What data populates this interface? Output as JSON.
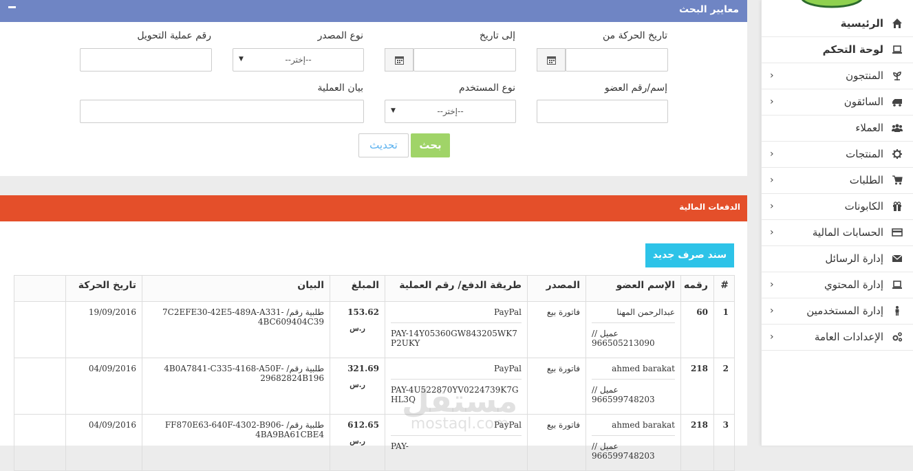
{
  "search": {
    "title": "معايير البحث",
    "labels": {
      "date_from": "تاريخ الحركة من",
      "date_to": "إلى تاريخ",
      "source_type": "نوع المصدر",
      "transfer_no": "رقم عملية التحويل",
      "member": "إسم/رقم العضو",
      "user_type": "نوع المستخدم",
      "description": "بيان العملية"
    },
    "select_placeholder": "--إختر--",
    "search_button": "بحث",
    "refresh_button": "تحديث"
  },
  "payments": {
    "title": "الدفعات المالية",
    "new_button": "سند صرف جديد",
    "columns": [
      "#",
      "رقمه",
      "الإسم العضو",
      "المصدر",
      "طريقة الدفع/ رقم العملية",
      "المبلغ",
      "البيان",
      "تاريخ الحركة"
    ],
    "rows": [
      {
        "idx": "1",
        "num": "60",
        "name": "عبدالرحمن المهنا",
        "phone": "عميل // 966505213090",
        "source": "فاتورة بيع",
        "method": "PayPal",
        "ref": "PAY-14Y05360GW843205WK7P2UKY",
        "amount": "153.62",
        "currency": "ر.س",
        "desc": "طلبية رقم/ -7C2EFE30-42E5-489A-A331 4BC609404C39",
        "date": "19/09/2016"
      },
      {
        "idx": "2",
        "num": "218",
        "name": "ahmed barakat",
        "phone": "عميل // 966599748203",
        "source": "فاتورة بيع",
        "method": "PayPal",
        "ref": "PAY-4U522870YV0224739K7GHL3Q",
        "amount": "321.69",
        "currency": "ر.س",
        "desc": "طلبية رقم/ -4B0A7841-C335-4168-A50F 29682824B196",
        "date": "04/09/2016"
      },
      {
        "idx": "3",
        "num": "218",
        "name": "ahmed barakat",
        "phone": "عميل // 966599748203",
        "source": "فاتورة بيع",
        "method": "PayPal",
        "ref": "PAY-",
        "amount": "612.65",
        "currency": "ر.س",
        "desc": "طلبية رقم/ -FF870E63-640F-4302-B906 4BA9BA61CBE4",
        "date": "04/09/2016"
      }
    ]
  },
  "sidebar": {
    "items": [
      {
        "label": "الرئيسية",
        "icon": "home-icon",
        "chevron": false
      },
      {
        "label": "لوحة التحكم",
        "icon": "laptop-icon",
        "chevron": false
      },
      {
        "label": "المنتجون",
        "icon": "leaf-icon",
        "chevron": true
      },
      {
        "label": "السائقون",
        "icon": "truck-icon",
        "chevron": true
      },
      {
        "label": "العملاء",
        "icon": "users-icon",
        "chevron": false
      },
      {
        "label": "المنتجات",
        "icon": "gear-icon",
        "chevron": true
      },
      {
        "label": "الطلبات",
        "icon": "cart-icon",
        "chevron": true
      },
      {
        "label": "الكابونات",
        "icon": "gift-icon",
        "chevron": true
      },
      {
        "label": "الحسابات المالية",
        "icon": "credit-card-icon",
        "chevron": true
      },
      {
        "label": "إدارة الرسائل",
        "icon": "envelope-icon",
        "chevron": false
      },
      {
        "label": "إدارة المحتوي",
        "icon": "laptop-icon",
        "chevron": true
      },
      {
        "label": "إدارة المستخدمين",
        "icon": "user-icon",
        "chevron": true
      },
      {
        "label": "الإعدادات العامة",
        "icon": "gears-icon",
        "chevron": true
      }
    ]
  },
  "watermark": {
    "line1": "مستقل",
    "line2": "mostaql.com"
  },
  "colors": {
    "search_header": "#6f85c4",
    "payments_header": "#e44f2a",
    "search_button": "#a0d468",
    "new_button": "#2dc3e8"
  }
}
